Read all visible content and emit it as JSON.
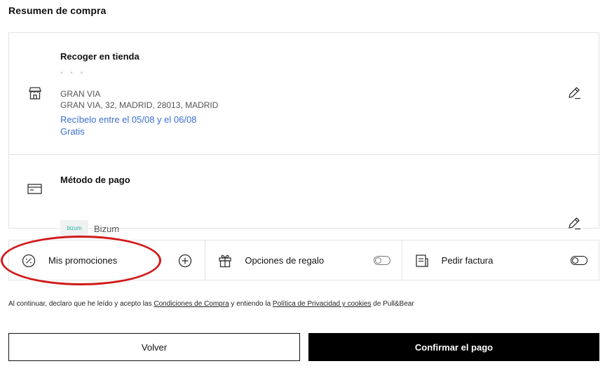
{
  "page": {
    "title": "Resumen de compra"
  },
  "shipping": {
    "label": "Recoger en tienda",
    "masked": "• • •",
    "store_name": "GRAN VIA",
    "address": "GRAN VIA, 32, MADRID, 28013, MADRID",
    "delivery_window": "Recíbelo entre el 05/08 y el 06/08",
    "cost": "Gratis",
    "icon": "store-icon",
    "edit_icon": "pencil-icon"
  },
  "payment": {
    "label": "Método de pago",
    "method": "Bizum",
    "logo_text": "bizum",
    "icon": "card-icon",
    "edit_icon": "pencil-icon"
  },
  "options": [
    {
      "label": "Mis promociones",
      "icon": "discount-icon",
      "action_icon": "plus-circle-icon"
    },
    {
      "label": "Opciones de regalo",
      "icon": "gift-icon",
      "toggle_on": false
    },
    {
      "label": "Pedir factura",
      "icon": "invoice-icon",
      "toggle_on": false
    }
  ],
  "legal": {
    "prefix": "Al continuar, declaro que he leído y acepto las ",
    "terms_link": "Condiciones de Compra",
    "middle": " y entiendo la ",
    "privacy_link": "Política de Privacidad y cookies",
    "suffix": " de Pull&Bear"
  },
  "buttons": {
    "back": "Volver",
    "confirm": "Confirmar el pago"
  },
  "colors": {
    "accent_blue": "#3a6fd0",
    "highlight_red": "#d11a1a",
    "primary_button": "#000000"
  }
}
